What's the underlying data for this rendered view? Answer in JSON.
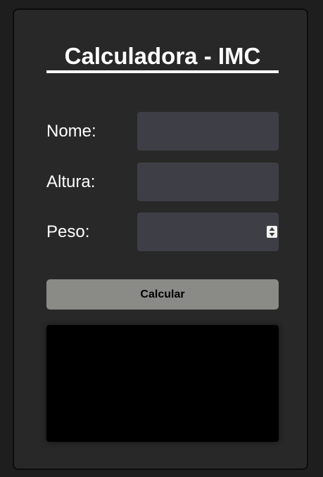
{
  "form": {
    "title": "Calculadora - IMC",
    "fields": [
      {
        "label": "Nome:",
        "value": ""
      },
      {
        "label": "Altura:",
        "value": ""
      },
      {
        "label": "Peso:",
        "value": ""
      }
    ],
    "submit_label": "Calcular",
    "result_text": ""
  },
  "icons": {
    "spinner": "number-spinner-icon"
  }
}
